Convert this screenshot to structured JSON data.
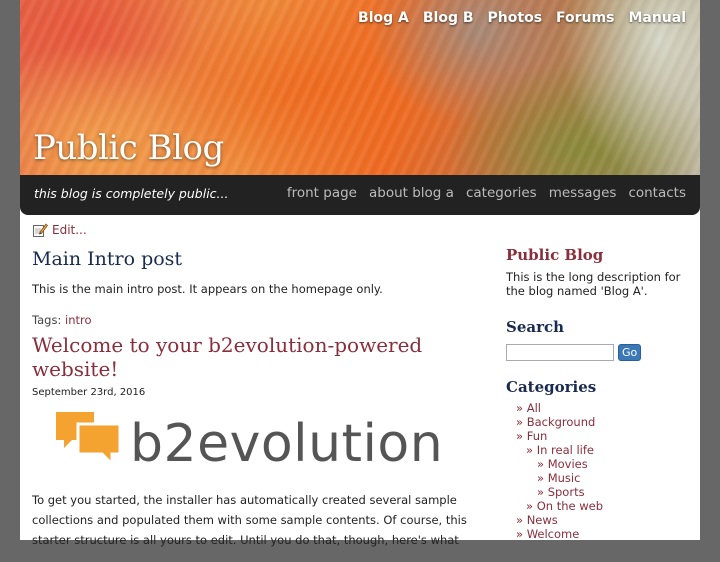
{
  "header": {
    "nav": [
      "Blog A",
      "Blog B",
      "Photos",
      "Forums",
      "Manual"
    ],
    "title": "Public Blog",
    "tagline": "this blog is completely public...",
    "menu": [
      "front page",
      "about blog a",
      "categories",
      "messages",
      "contacts"
    ]
  },
  "main": {
    "edit_label": "Edit...",
    "intro": {
      "title": "Main Intro post",
      "body": "This is the main intro post. It appears on the homepage only.",
      "tags_label": "Tags:",
      "tag": "intro"
    },
    "post": {
      "title": "Welcome to your b2evolution-powered website!",
      "date": "September 23rd, 2016",
      "logo_text": "b2evolution",
      "body": "To get you started, the installer has automatically created several sample collections and populated them with some sample contents. Of course, this starter structure is all yours to edit. Until you do that, though, here's what"
    }
  },
  "sidebar": {
    "blog_title": "Public Blog",
    "blog_desc": "This is the long description for the blog named 'Blog A'.",
    "search_title": "Search",
    "search_value": "",
    "search_button": "Go",
    "categories_title": "Categories",
    "categories": [
      {
        "label": "All",
        "level": 0
      },
      {
        "label": "Background",
        "level": 0
      },
      {
        "label": "Fun",
        "level": 0
      },
      {
        "label": "In real life",
        "level": 1
      },
      {
        "label": "Movies",
        "level": 2
      },
      {
        "label": "Music",
        "level": 2
      },
      {
        "label": "Sports",
        "level": 2
      },
      {
        "label": "On the web",
        "level": 1
      },
      {
        "label": "News",
        "level": 0
      },
      {
        "label": "Welcome",
        "level": 0
      }
    ]
  },
  "colors": {
    "accent": "#8a2e3b",
    "heading_dark": "#1a2b50",
    "logo_orange": "#f4a230"
  },
  "icons": {
    "edit": "pencil-icon",
    "logo": "speech-bubbles-logo-icon"
  }
}
